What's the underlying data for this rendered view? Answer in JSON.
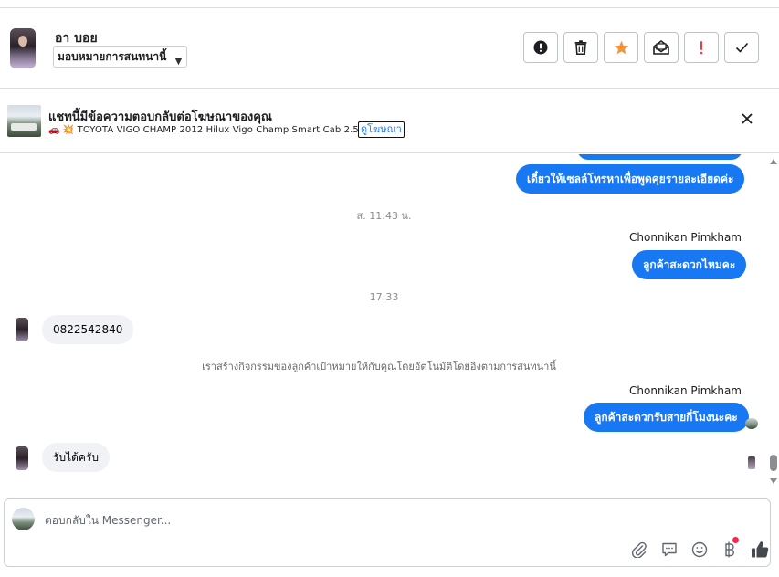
{
  "header": {
    "contact_name": "อา บอย",
    "assign_label": "มอบหมายการสนทนานี้",
    "actions": [
      {
        "icon": "alert-circle-icon",
        "name": "mark-spam-button"
      },
      {
        "icon": "trash-icon",
        "name": "delete-button"
      },
      {
        "icon": "star-icon",
        "name": "star-button"
      },
      {
        "icon": "unread-mail-icon",
        "name": "mark-unread-button"
      },
      {
        "icon": "exclamation-icon",
        "name": "follow-up-button"
      },
      {
        "icon": "check-icon",
        "name": "done-button"
      }
    ],
    "star_color": "#f7923a",
    "alert_color": "#fa383e"
  },
  "ad_banner": {
    "title": "แชทนี้มีข้อความตอบกลับต่อโฆษณาของคุณ",
    "subtitle": "TOYOTA VIGO CHAMP 2012 Hilux Vigo Champ Smart Cab 2.5 ...",
    "subtitle_emoji": "🚗 💥",
    "link_label": "ดูโฆษณา"
  },
  "messages": {
    "out_partial_top": "",
    "out_1": "เดี๋ยวให้เซลล์โทรหาเพื่อพูดคุยรายละเอียดค่ะ",
    "stamp_1": "ส. 11:43 น.",
    "sender_1": "Chonnikan Pimkham",
    "out_2": "ลูกค้าสะดวกไหมคะ",
    "stamp_2": "17:33",
    "in_1": "0822542840",
    "system_note": "เราสร้างกิจกรรมของลูกค้าเป้าหมายให้กับคุณโดยอัตโนมัติโดยอิงตามการสนทนานี้",
    "sender_2": "Chonnikan Pimkham",
    "out_3": "ลูกค้าสะดวกรับสายกี่โมงนะคะ",
    "in_2": "รับได้ครับ"
  },
  "composer": {
    "placeholder": "ตอบกลับใน Messenger...",
    "tools": [
      "paperclip-icon",
      "chat-bubble-icon",
      "smiley-icon",
      "baht-icon",
      "thumbs-up-icon"
    ]
  },
  "colors": {
    "accent": "#1877f2",
    "incoming_bubble": "#f0f2f5",
    "notification_dot": "#f02849"
  }
}
